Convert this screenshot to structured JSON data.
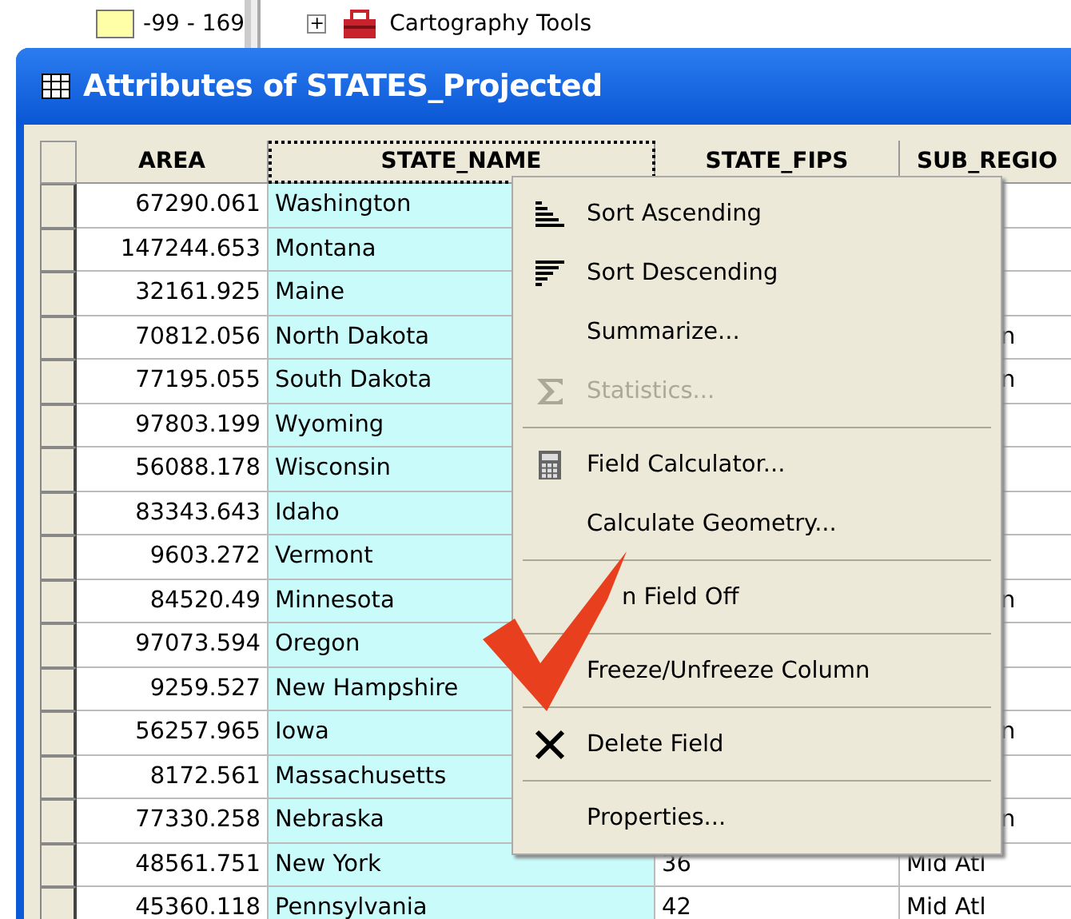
{
  "background": {
    "legend_label": "-99 - 169",
    "toolbox_label": "Cartography Tools",
    "expand_glyph": "+"
  },
  "window": {
    "title": "Attributes of STATES_Projected"
  },
  "table": {
    "columns": [
      {
        "label": "AREA",
        "selected": false
      },
      {
        "label": "STATE_NAME",
        "selected": true
      },
      {
        "label": "STATE_FIPS",
        "selected": false
      },
      {
        "label": "SUB_REGIO",
        "selected": false
      }
    ],
    "rows": [
      {
        "area": "67290.061",
        "state_name": "Washington"
      },
      {
        "area": "147244.653",
        "state_name": "Montana"
      },
      {
        "area": "32161.925",
        "state_name": "Maine"
      },
      {
        "area": "70812.056",
        "state_name": "North Dakota",
        "sub_region": "n"
      },
      {
        "area": "77195.055",
        "state_name": "South Dakota",
        "sub_region": "n"
      },
      {
        "area": "97803.199",
        "state_name": "Wyoming"
      },
      {
        "area": "56088.178",
        "state_name": "Wisconsin"
      },
      {
        "area": "83343.643",
        "state_name": "Idaho"
      },
      {
        "area": "9603.272",
        "state_name": "Vermont"
      },
      {
        "area": "84520.49",
        "state_name": "Minnesota",
        "sub_region": "n"
      },
      {
        "area": "97073.594",
        "state_name": "Oregon"
      },
      {
        "area": "9259.527",
        "state_name": "New Hampshire"
      },
      {
        "area": "56257.965",
        "state_name": "Iowa",
        "sub_region": "n"
      },
      {
        "area": "8172.561",
        "state_name": "Massachusetts"
      },
      {
        "area": "77330.258",
        "state_name": "Nebraska",
        "sub_region": "n"
      },
      {
        "area": "48561.751",
        "state_name": "New York",
        "state_fips": "36",
        "sub_region": "Mid Atl"
      },
      {
        "area": "45360.118",
        "state_name": "Pennsylvania",
        "state_fips": "42",
        "sub_region": "Mid Atl"
      }
    ]
  },
  "context_menu": {
    "items": [
      {
        "kind": "ascending",
        "label": "Sort Ascending",
        "disabled": false
      },
      {
        "kind": "descending",
        "label": "Sort Descending",
        "disabled": false
      },
      {
        "kind": "plain",
        "label": "Summarize...",
        "disabled": false
      },
      {
        "kind": "sigma",
        "label": "Statistics...",
        "disabled": true
      },
      {
        "kind": "separator"
      },
      {
        "kind": "calculator",
        "label": "Field Calculator...",
        "disabled": false
      },
      {
        "kind": "plain",
        "label": "Calculate Geometry...",
        "disabled": false
      },
      {
        "kind": "separator"
      },
      {
        "kind": "covered",
        "label": "n Field Off",
        "disabled": false
      },
      {
        "kind": "separator"
      },
      {
        "kind": "plain",
        "label": "Freeze/Unfreeze Column",
        "disabled": false
      },
      {
        "kind": "separator"
      },
      {
        "kind": "delete",
        "label": "Delete Field",
        "disabled": false
      },
      {
        "kind": "separator"
      },
      {
        "kind": "plain",
        "label": "Properties...",
        "disabled": false
      }
    ]
  }
}
